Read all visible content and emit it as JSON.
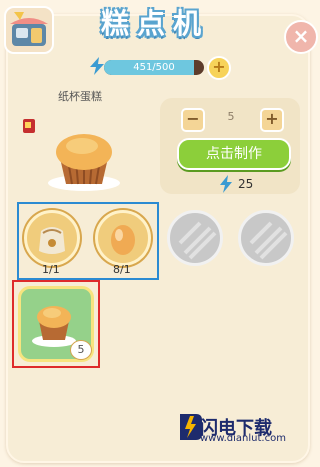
{
  "header": {
    "title": "糕点机",
    "close_label": "×"
  },
  "energy": {
    "current": 451,
    "max": 500,
    "text": "451/500",
    "fill_fraction": 0.902,
    "add_label": "+"
  },
  "recipe": {
    "name": "纸杯蛋糕",
    "quantity": "5",
    "minus_label": "−",
    "plus_label": "+",
    "make_label": "点击制作",
    "cost": "25"
  },
  "ingredients": [
    {
      "icon": "flour-sack-icon",
      "count": "1/1"
    },
    {
      "icon": "egg-icon",
      "count": "8/1"
    }
  ],
  "output": {
    "icon": "muffin-icon",
    "count": "5"
  },
  "watermark": {
    "name": "闪电下载",
    "url": "www.dianlut.com"
  }
}
